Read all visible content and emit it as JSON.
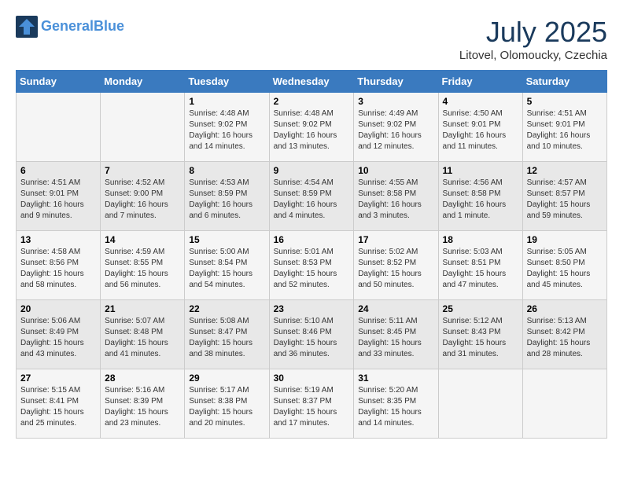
{
  "logo": {
    "line1": "General",
    "line2": "Blue"
  },
  "title": "July 2025",
  "subtitle": "Litovel, Olomoucky, Czechia",
  "headers": [
    "Sunday",
    "Monday",
    "Tuesday",
    "Wednesday",
    "Thursday",
    "Friday",
    "Saturday"
  ],
  "weeks": [
    [
      {
        "day": "",
        "details": ""
      },
      {
        "day": "",
        "details": ""
      },
      {
        "day": "1",
        "details": "Sunrise: 4:48 AM\nSunset: 9:02 PM\nDaylight: 16 hours\nand 14 minutes."
      },
      {
        "day": "2",
        "details": "Sunrise: 4:48 AM\nSunset: 9:02 PM\nDaylight: 16 hours\nand 13 minutes."
      },
      {
        "day": "3",
        "details": "Sunrise: 4:49 AM\nSunset: 9:02 PM\nDaylight: 16 hours\nand 12 minutes."
      },
      {
        "day": "4",
        "details": "Sunrise: 4:50 AM\nSunset: 9:01 PM\nDaylight: 16 hours\nand 11 minutes."
      },
      {
        "day": "5",
        "details": "Sunrise: 4:51 AM\nSunset: 9:01 PM\nDaylight: 16 hours\nand 10 minutes."
      }
    ],
    [
      {
        "day": "6",
        "details": "Sunrise: 4:51 AM\nSunset: 9:01 PM\nDaylight: 16 hours\nand 9 minutes."
      },
      {
        "day": "7",
        "details": "Sunrise: 4:52 AM\nSunset: 9:00 PM\nDaylight: 16 hours\nand 7 minutes."
      },
      {
        "day": "8",
        "details": "Sunrise: 4:53 AM\nSunset: 8:59 PM\nDaylight: 16 hours\nand 6 minutes."
      },
      {
        "day": "9",
        "details": "Sunrise: 4:54 AM\nSunset: 8:59 PM\nDaylight: 16 hours\nand 4 minutes."
      },
      {
        "day": "10",
        "details": "Sunrise: 4:55 AM\nSunset: 8:58 PM\nDaylight: 16 hours\nand 3 minutes."
      },
      {
        "day": "11",
        "details": "Sunrise: 4:56 AM\nSunset: 8:58 PM\nDaylight: 16 hours\nand 1 minute."
      },
      {
        "day": "12",
        "details": "Sunrise: 4:57 AM\nSunset: 8:57 PM\nDaylight: 15 hours\nand 59 minutes."
      }
    ],
    [
      {
        "day": "13",
        "details": "Sunrise: 4:58 AM\nSunset: 8:56 PM\nDaylight: 15 hours\nand 58 minutes."
      },
      {
        "day": "14",
        "details": "Sunrise: 4:59 AM\nSunset: 8:55 PM\nDaylight: 15 hours\nand 56 minutes."
      },
      {
        "day": "15",
        "details": "Sunrise: 5:00 AM\nSunset: 8:54 PM\nDaylight: 15 hours\nand 54 minutes."
      },
      {
        "day": "16",
        "details": "Sunrise: 5:01 AM\nSunset: 8:53 PM\nDaylight: 15 hours\nand 52 minutes."
      },
      {
        "day": "17",
        "details": "Sunrise: 5:02 AM\nSunset: 8:52 PM\nDaylight: 15 hours\nand 50 minutes."
      },
      {
        "day": "18",
        "details": "Sunrise: 5:03 AM\nSunset: 8:51 PM\nDaylight: 15 hours\nand 47 minutes."
      },
      {
        "day": "19",
        "details": "Sunrise: 5:05 AM\nSunset: 8:50 PM\nDaylight: 15 hours\nand 45 minutes."
      }
    ],
    [
      {
        "day": "20",
        "details": "Sunrise: 5:06 AM\nSunset: 8:49 PM\nDaylight: 15 hours\nand 43 minutes."
      },
      {
        "day": "21",
        "details": "Sunrise: 5:07 AM\nSunset: 8:48 PM\nDaylight: 15 hours\nand 41 minutes."
      },
      {
        "day": "22",
        "details": "Sunrise: 5:08 AM\nSunset: 8:47 PM\nDaylight: 15 hours\nand 38 minutes."
      },
      {
        "day": "23",
        "details": "Sunrise: 5:10 AM\nSunset: 8:46 PM\nDaylight: 15 hours\nand 36 minutes."
      },
      {
        "day": "24",
        "details": "Sunrise: 5:11 AM\nSunset: 8:45 PM\nDaylight: 15 hours\nand 33 minutes."
      },
      {
        "day": "25",
        "details": "Sunrise: 5:12 AM\nSunset: 8:43 PM\nDaylight: 15 hours\nand 31 minutes."
      },
      {
        "day": "26",
        "details": "Sunrise: 5:13 AM\nSunset: 8:42 PM\nDaylight: 15 hours\nand 28 minutes."
      }
    ],
    [
      {
        "day": "27",
        "details": "Sunrise: 5:15 AM\nSunset: 8:41 PM\nDaylight: 15 hours\nand 25 minutes."
      },
      {
        "day": "28",
        "details": "Sunrise: 5:16 AM\nSunset: 8:39 PM\nDaylight: 15 hours\nand 23 minutes."
      },
      {
        "day": "29",
        "details": "Sunrise: 5:17 AM\nSunset: 8:38 PM\nDaylight: 15 hours\nand 20 minutes."
      },
      {
        "day": "30",
        "details": "Sunrise: 5:19 AM\nSunset: 8:37 PM\nDaylight: 15 hours\nand 17 minutes."
      },
      {
        "day": "31",
        "details": "Sunrise: 5:20 AM\nSunset: 8:35 PM\nDaylight: 15 hours\nand 14 minutes."
      },
      {
        "day": "",
        "details": ""
      },
      {
        "day": "",
        "details": ""
      }
    ]
  ]
}
